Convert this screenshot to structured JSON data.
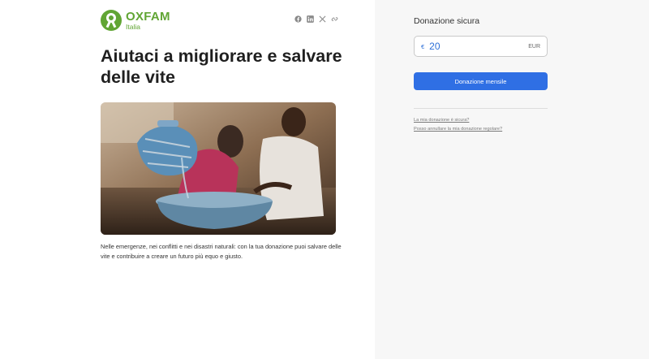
{
  "brand": {
    "name": "OXFAM",
    "sub": "Italia",
    "color": "#61a534"
  },
  "share": {
    "icons": [
      "facebook-icon",
      "linkedin-icon",
      "x-icon",
      "link-icon"
    ]
  },
  "article": {
    "title": "Aiutaci a migliorare e salvare delle vite",
    "description": "Nelle emergenze, nei conflitti e nei disastri naturali: con la tua donazione puoi salvare delle vite e contribuire a creare un futuro più equo e giusto."
  },
  "donation": {
    "title": "Donazione sicura",
    "currency_symbol": "€",
    "amount": "20",
    "currency_code": "EUR",
    "button_label": "Donazione mensile",
    "accent": "#2f6fe4",
    "links": [
      "La mia donazione è sicura?",
      "Posso annullare la mia donazione regolare?"
    ]
  }
}
